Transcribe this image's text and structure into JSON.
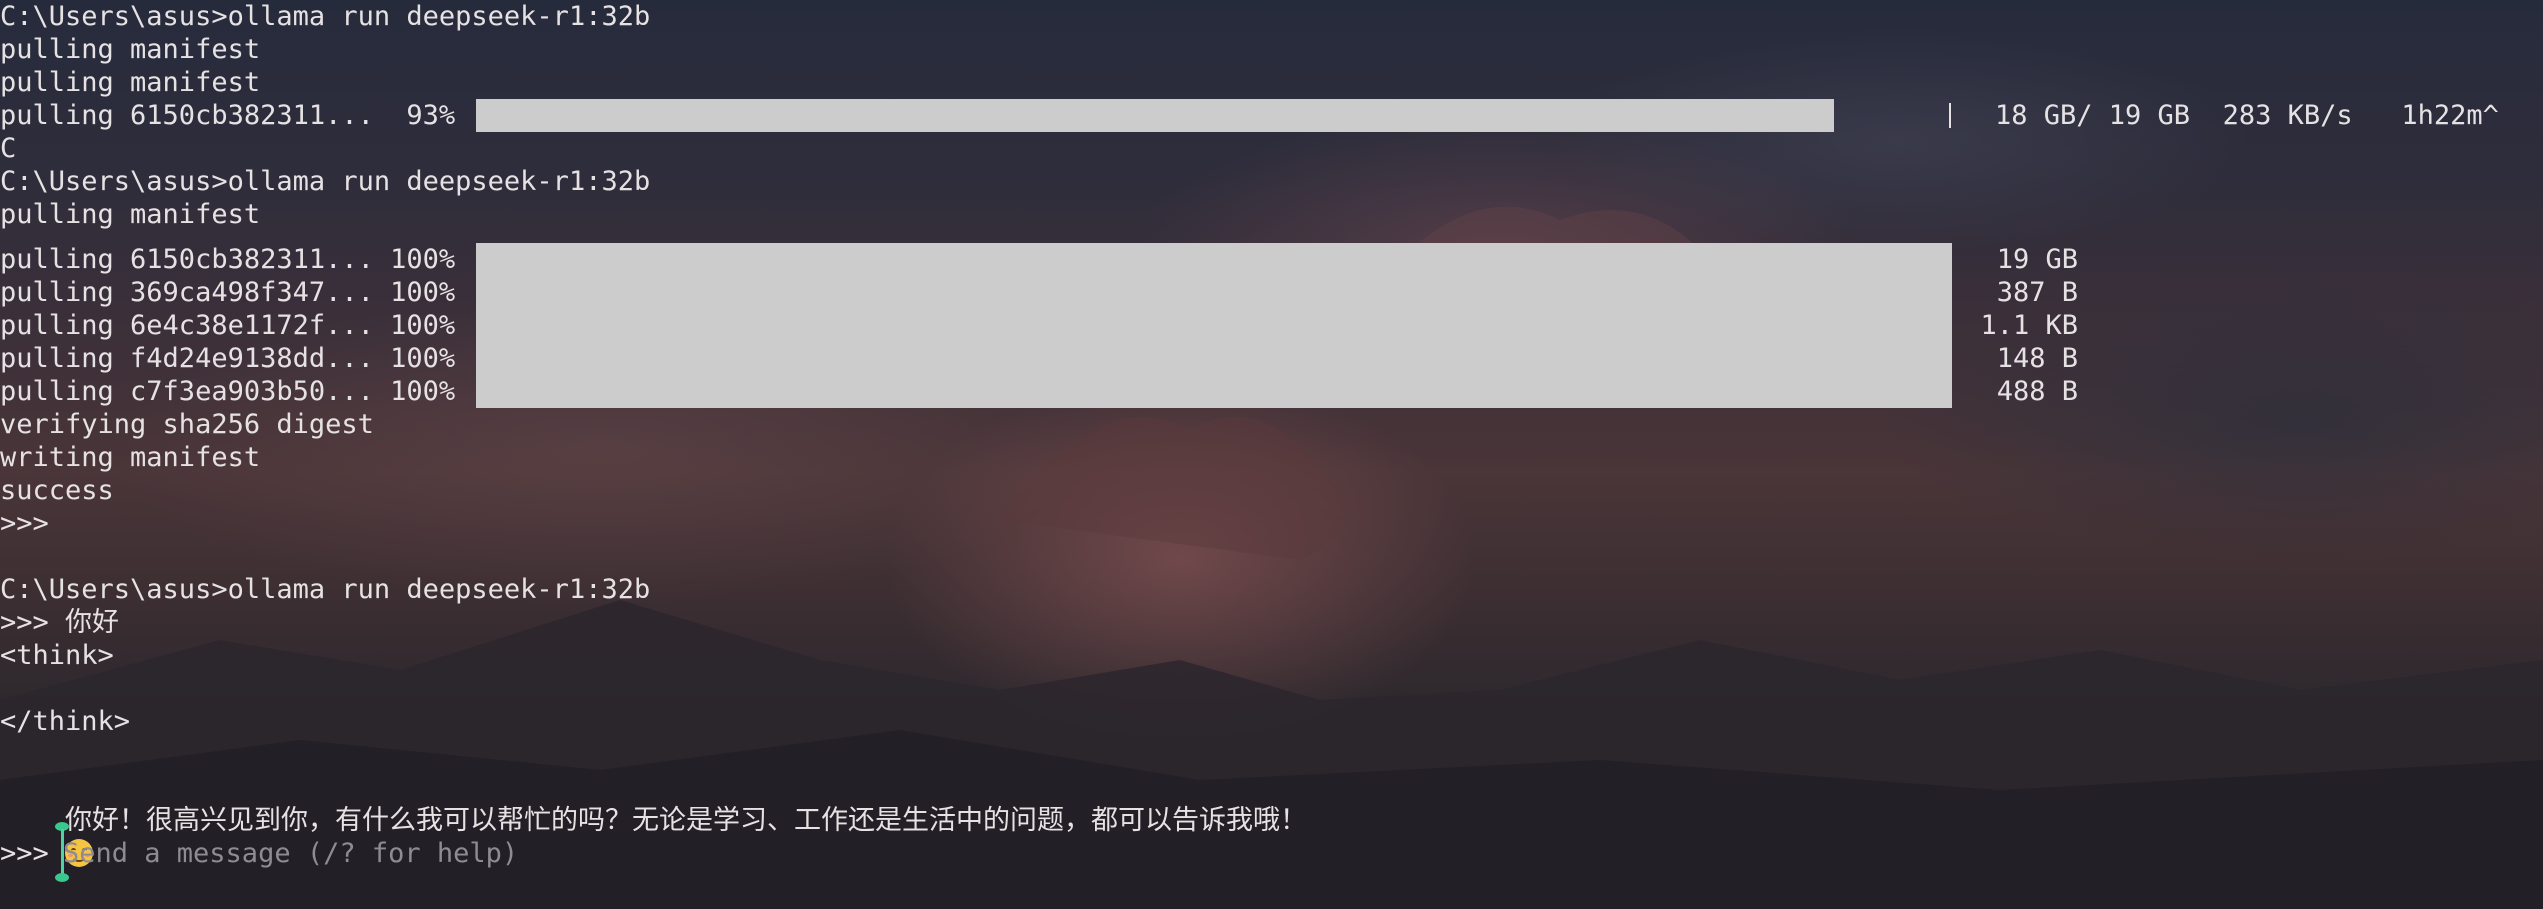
{
  "terminal": {
    "lines": {
      "cmd1": "C:\\Users\\asus>ollama run deepseek-r1:32b",
      "manifest1": "pulling manifest",
      "manifest2": "pulling manifest",
      "pull_partial_label": "pulling 6150cb382311...  93%",
      "pull_partial_stats": "18 GB/ 19 GB  283 KB/s   1h22m^",
      "interrupt": "C",
      "cmd2": "C:\\Users\\asus>ollama run deepseek-r1:32b",
      "manifest3": "pulling manifest",
      "verify": "verifying sha256 digest",
      "writing": "writing manifest",
      "success": "success",
      "prompt_empty": ">>>",
      "cmd3": "C:\\Users\\asus>ollama run deepseek-r1:32b",
      "user_msg": ">>> 你好",
      "think_open": "<think>",
      "think_close": "</think>",
      "reply": "你好！很高兴见到你，有什么我可以帮忙的吗？无论是学习、工作还是生活中的问题，都可以告诉我哦！",
      "input_prompt": ">>>"
    },
    "partial_progress": 0.93,
    "pull_layers": [
      {
        "label": "pulling 6150cb382311... 100%",
        "size": "19 GB",
        "progress": 1.0
      },
      {
        "label": "pulling 369ca498f347... 100%",
        "size": "387 B",
        "progress": 1.0
      },
      {
        "label": "pulling 6e4c38e1172f... 100%",
        "size": "1.1 KB",
        "progress": 1.0
      },
      {
        "label": "pulling f4d24e9138dd... 100%",
        "size": "148 B",
        "progress": 1.0
      },
      {
        "label": "pulling c7f3ea903b50... 100%",
        "size": "488 B",
        "progress": 1.0
      }
    ],
    "input": {
      "placeholder": "Send a message (/? for help)"
    },
    "emoji_icon": "smiling-face-icon",
    "colors": {
      "text": "#e6e2e4",
      "progress_bar": "#cccccc",
      "placeholder": "#8f8b93",
      "cursor": "#4fd3a0"
    }
  }
}
